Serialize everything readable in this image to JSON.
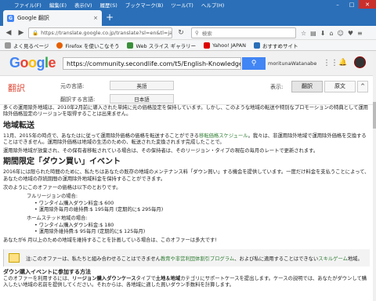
{
  "menu": [
    "ファイル(F)",
    "編集(E)",
    "表示(V)",
    "履歴(S)",
    "ブックマーク(B)",
    "ツール(T)",
    "ヘルプ(H)"
  ],
  "tab": {
    "title": "Google 翻訳",
    "close": "×",
    "new": "+"
  },
  "nav": {
    "url": "https://translate.google.co.jp/translate?sl=en&tl=ja&js=y&p",
    "search_placeholder": "検索"
  },
  "bookmarks": [
    "よく見るページ",
    "Firefox を使いこなそう",
    "Web スライス ギャラリー",
    "Yahoo! JAPAN",
    "おすすめサイト"
  ],
  "google": {
    "logo": "Google",
    "url": "https://community.secondlife.com/t5/English-Knowledge-Base.",
    "user": "moritunaWatanabe"
  },
  "translate": {
    "label": "翻訳",
    "src_label": "元の言語:",
    "src_value": "英語",
    "tgt_label": "翻訳する言語:",
    "tgt_value": "日本語",
    "display_label": "表示:",
    "btn_translation": "翻訳",
    "btn_original": "原文",
    "btn_collapse": "^"
  },
  "content": {
    "p1": "多くの運用除外地域は、2010年2月前に導入された単純に元の価格設定を保持しています。しかし、このような地域の転送や特別なプロモーションの特典として運用除外価格設定のリージョンを取得することは出来ません。",
    "h1": "地域転送",
    "p2a": "11月、2015年の時点で、あなたはに従って運用除外価格の価格を転送することができる",
    "p2link": "移転価格スケジュール",
    "p2b": "。我々は、非運用除外地域で運用除外価格を交換することはできません。運用除外価格は地域の生活のための、転送された変換されます完成したことで。",
    "p3": "運用除外地域が放棄され、その保有者移転されている場合は、その保持者は、そのリージョン・タイプの現在の毎月のレートで更新されます。",
    "h2": "期間限定「ダウン買い」イベント",
    "p4": "2016年には限られた時間のために、私たちはあなたの既存の地域のメンテナンス料「ダウン買い」する機会を提供しています。一度だけ料金を支払うことによって、あなたの地域の存続期間の運用除外地域料金を保持することができます。",
    "p5": "次のようにこのオファーの価格は以下のとおりです。",
    "full_label": "フルリージョンの場合:",
    "full_items": [
      "ワンタイム購入ダウン料金:$ 600",
      "運用除外毎月の維持費:$ 195毎月 (定期的に$ 295毎月)"
    ],
    "home_label": "ホームステッド地域の場合:",
    "home_items": [
      "ワンタイム購入ダウン料金:$ 180",
      "運用除外維持費:$ 95毎月 (定期的に$ 125毎月)"
    ],
    "p6": "あなたが6 月以上のための地域を維持することを計画している場合は、このオファーは多大です!",
    "note_a": "注:このオファーは、私たちと組み合わせることはできません",
    "note_link1": "教育や非営利団体割引プログラム",
    "note_b": "、および私に適用することはできない",
    "note_link2": "スキルゲーム",
    "note_c": "地域。",
    "h3": "ダウン購入イベントに参加する方法",
    "p7a": "このオファーを利用するには、",
    "p7b": "リージョン購入ダウンケース",
    "p7c": "タイプで",
    "p7d": "土地＆地域",
    "p7e": "カテゴリにサポートケースを提出します。ケースの説明では、あなたがダウンして購入したい地域の名前を提供してください。それからは、各地域に適した買いダウン手数料を計算します。"
  }
}
